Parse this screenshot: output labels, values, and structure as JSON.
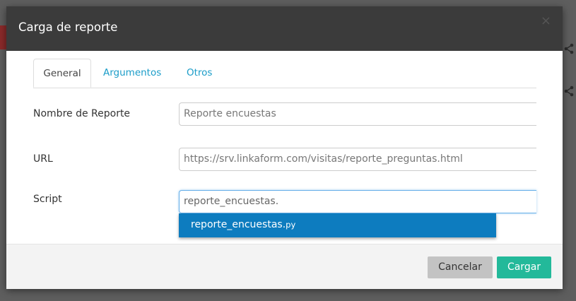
{
  "dialog": {
    "title": "Carga de reporte",
    "close_symbol": "×"
  },
  "tabs": [
    {
      "label": "General",
      "active": true
    },
    {
      "label": "Argumentos",
      "active": false
    },
    {
      "label": "Otros",
      "active": false
    }
  ],
  "form": {
    "name": {
      "label": "Nombre de Reporte",
      "value": "Reporte encuestas"
    },
    "url": {
      "label": "URL",
      "value": "https://srv.linkaform.com/visitas/reporte_preguntas.html"
    },
    "script": {
      "label": "Script",
      "value": "reporte_encuestas."
    }
  },
  "autocomplete": {
    "item_name": "reporte_encuestas.",
    "item_ext": "py"
  },
  "footer": {
    "cancel_label": "Cancelar",
    "load_label": "Cargar"
  },
  "colors": {
    "header_bg": "#3b3b3b",
    "accent_link": "#1a9cc8",
    "dropdown_highlight": "#0d7cbf",
    "primary_button": "#23b99a",
    "cancel_button": "#c3c3c3"
  },
  "icons": [
    "share-icon",
    "close-icon"
  ]
}
